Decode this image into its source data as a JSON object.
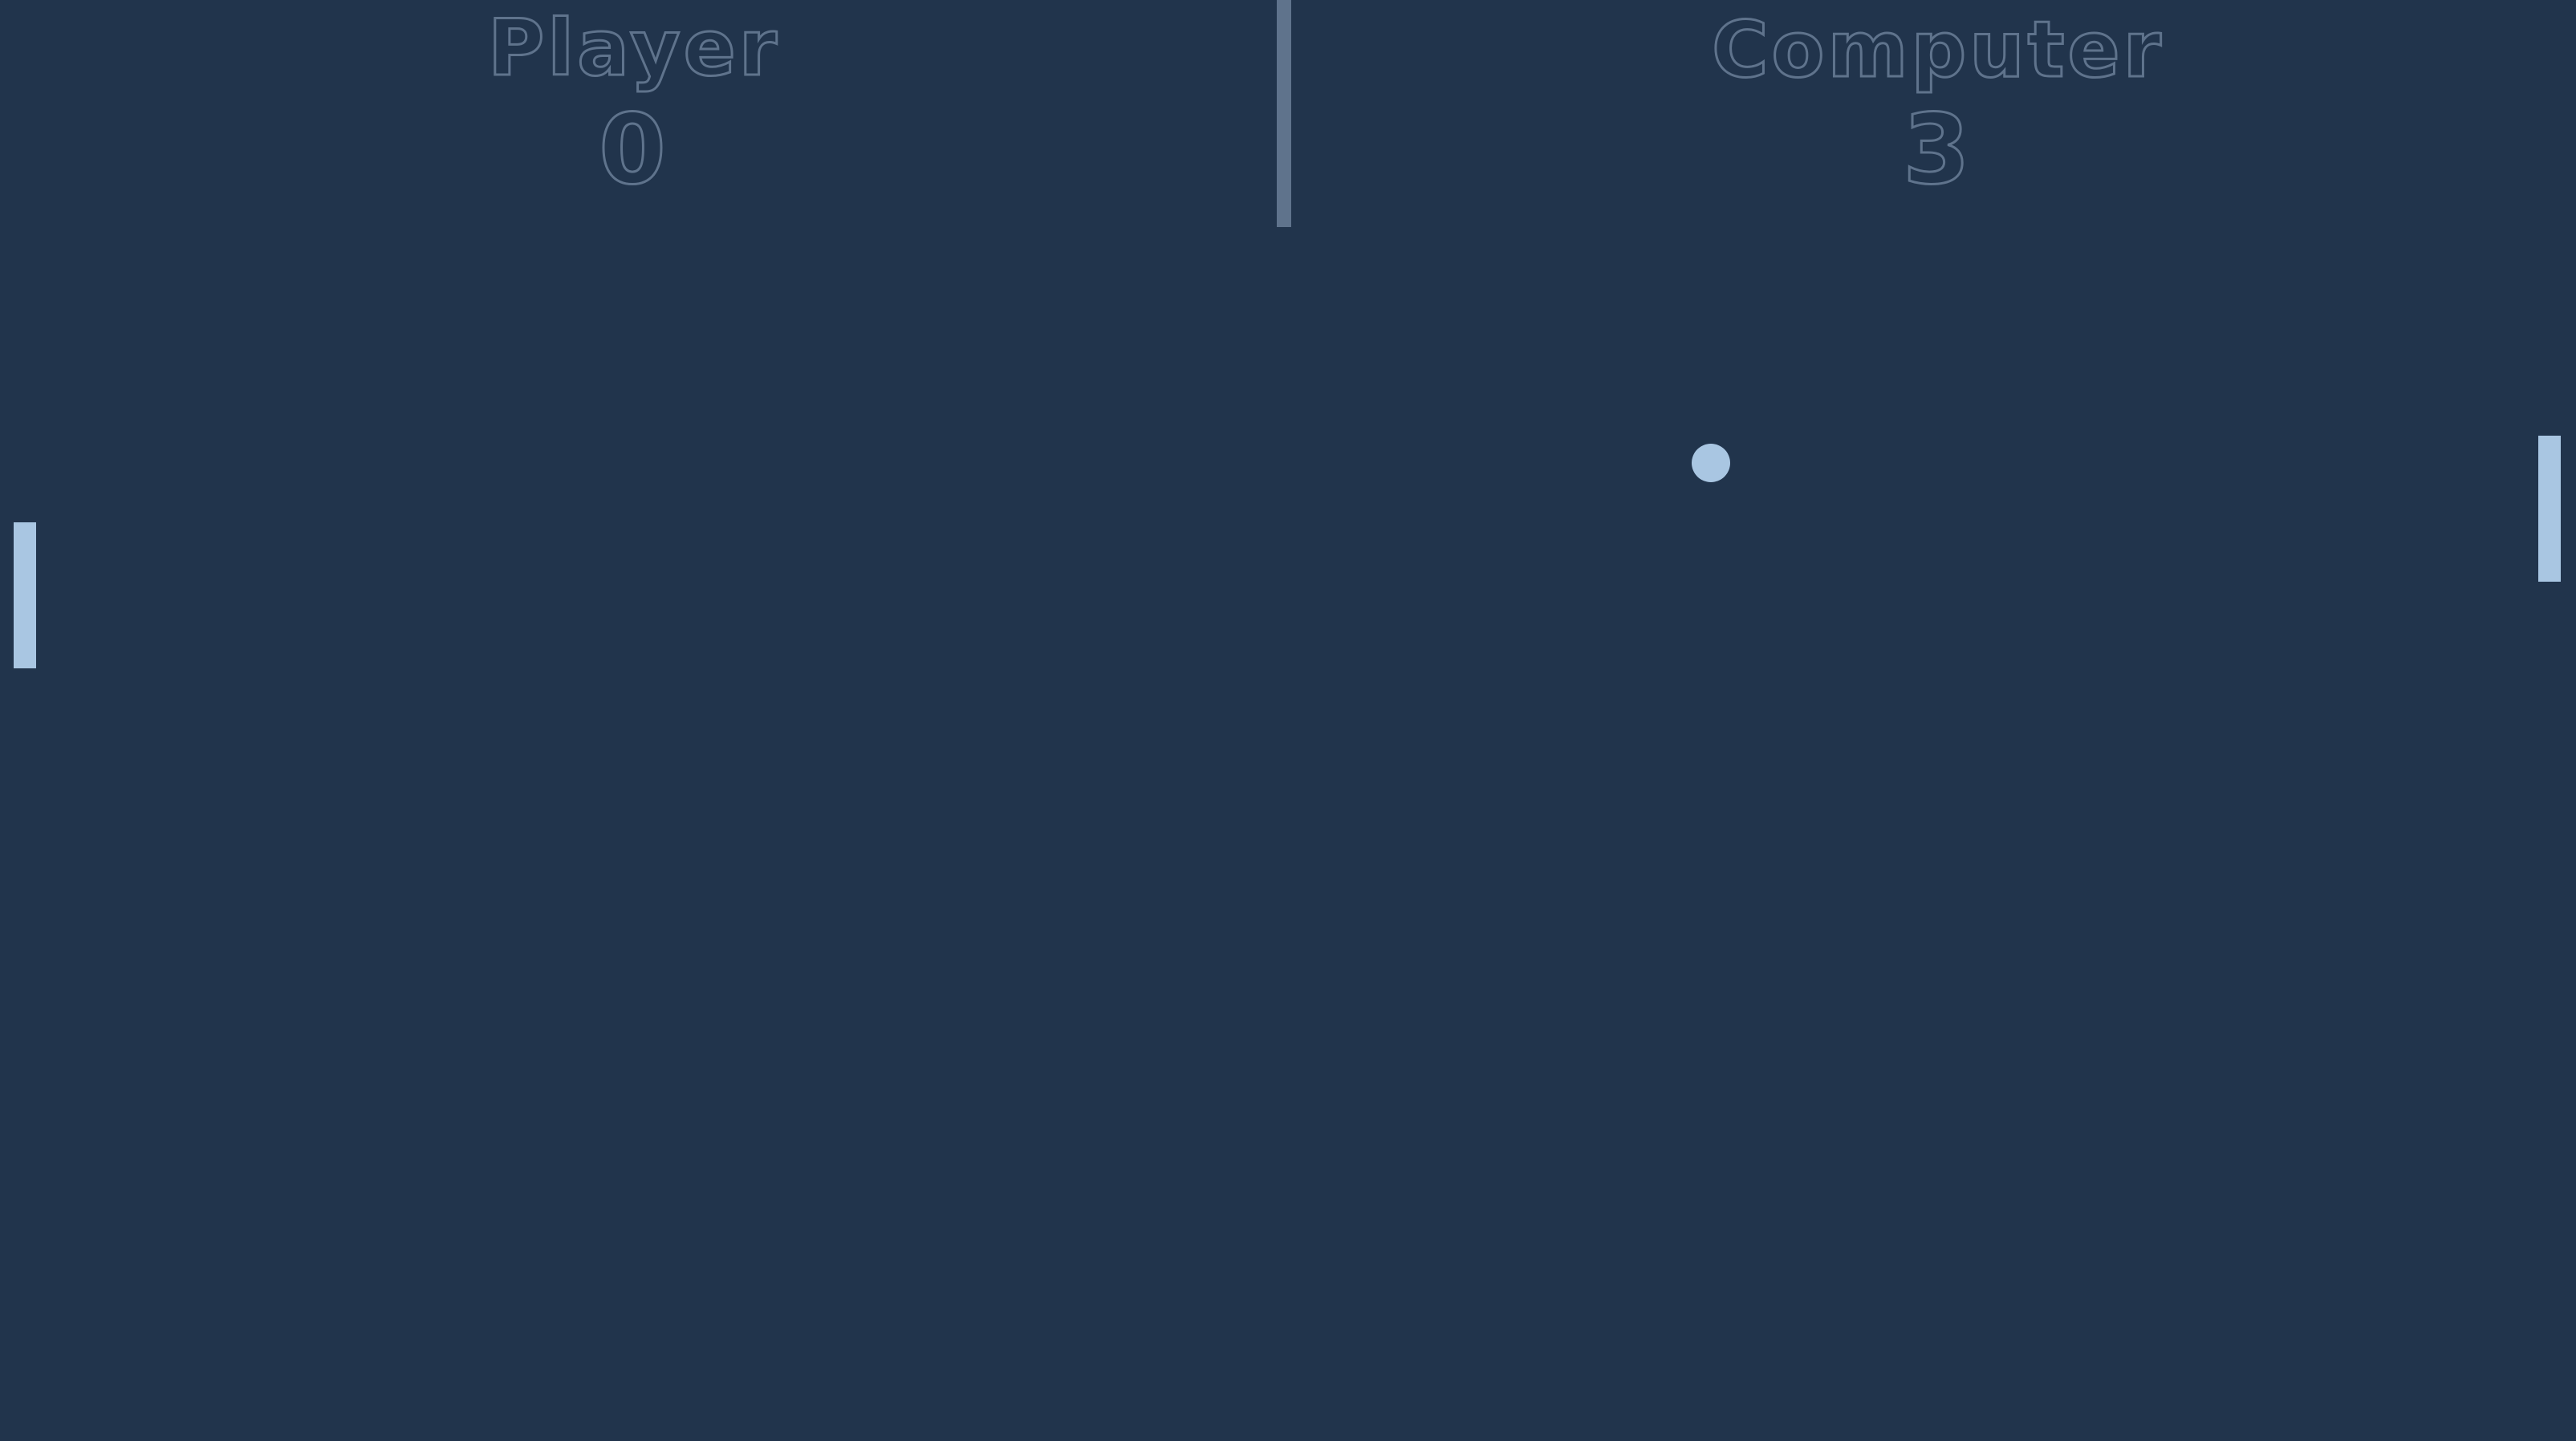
{
  "players": {
    "left_name": "Player",
    "right_name": "Computer"
  },
  "score": {
    "player": "0",
    "computer": "3"
  },
  "colors": {
    "background": "#21344c",
    "ink": "#5f738c",
    "paddle": "#a9c6e2",
    "ball": "#a9c6e2"
  }
}
